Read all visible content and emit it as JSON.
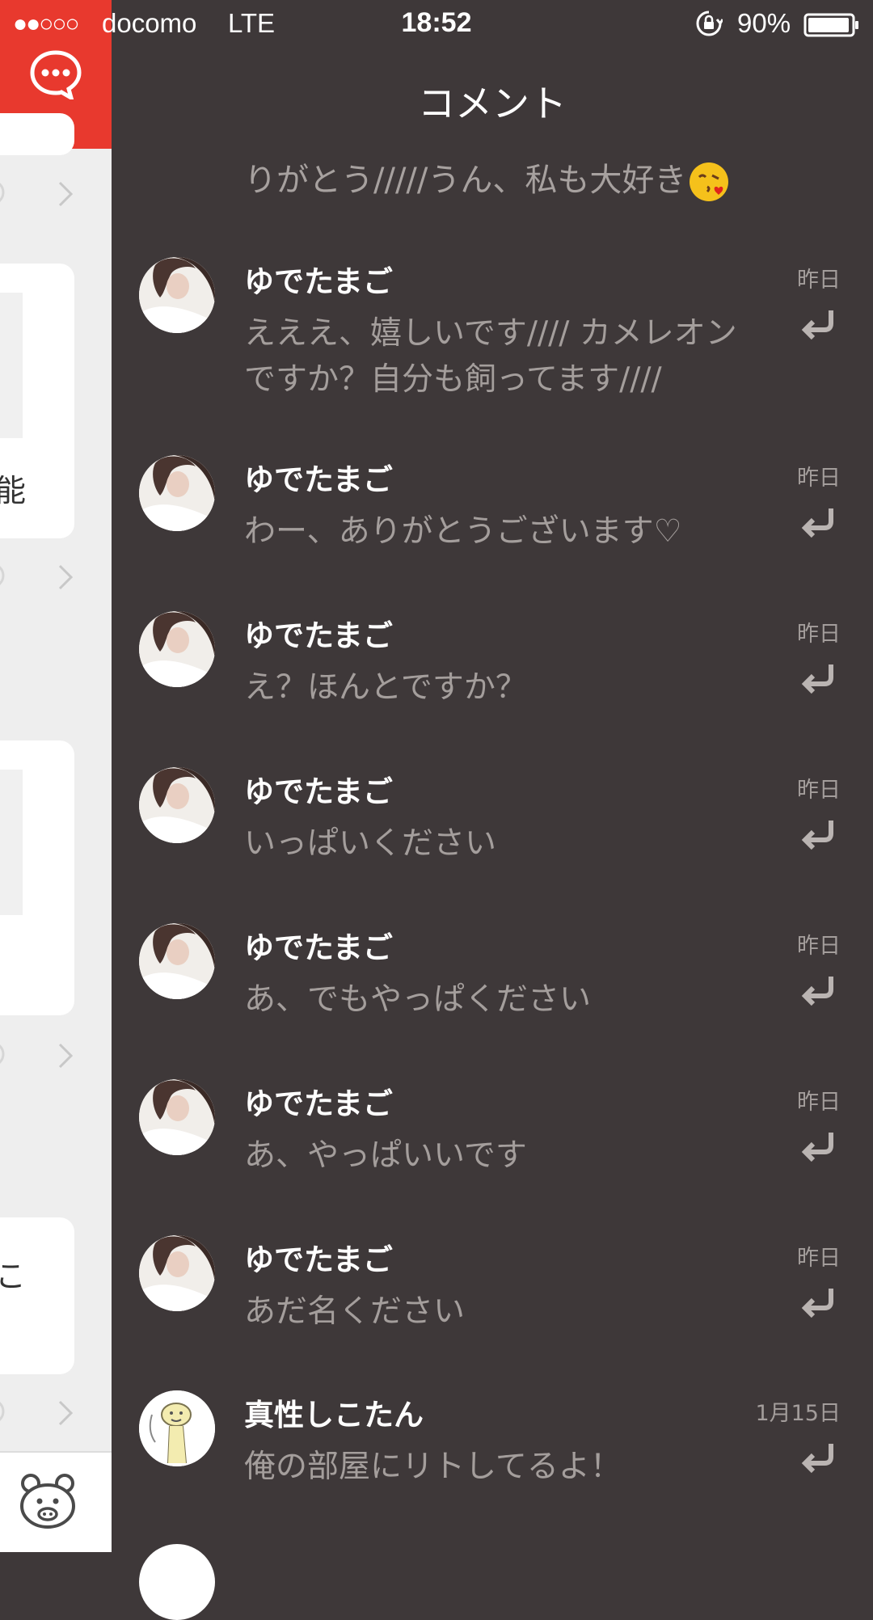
{
  "status_bar": {
    "signal": "●●○○○",
    "carrier": "docomo",
    "network": "LTE",
    "time": "18:52",
    "battery": "90%"
  },
  "header": {
    "title": "コメント"
  },
  "left_app": {
    "fragments": [
      "能",
      "こ"
    ]
  },
  "partial_comment": {
    "text": "りがとう/////うん、私も大好き",
    "emoji": "kissing-face-icon"
  },
  "comments": [
    {
      "name": "ゆでたまご",
      "date": "昨日",
      "text": "えええ、嬉しいです//// カメレオンですか？自分も飼ってます////",
      "avatar": "girl-photo"
    },
    {
      "name": "ゆでたまご",
      "date": "昨日",
      "text": "わー、ありがとうございます♡",
      "avatar": "girl-photo"
    },
    {
      "name": "ゆでたまご",
      "date": "昨日",
      "text": "え？ほんとですか？",
      "avatar": "girl-photo"
    },
    {
      "name": "ゆでたまご",
      "date": "昨日",
      "text": "いっぱいください",
      "avatar": "girl-photo"
    },
    {
      "name": "ゆでたまご",
      "date": "昨日",
      "text": "あ、でもやっぱください",
      "avatar": "girl-photo"
    },
    {
      "name": "ゆでたまご",
      "date": "昨日",
      "text": "あ、やっぱいいです",
      "avatar": "girl-photo"
    },
    {
      "name": "ゆでたまご",
      "date": "昨日",
      "text": "あだ名ください",
      "avatar": "girl-photo"
    },
    {
      "name": "真性しこたん",
      "date": "1月15日",
      "text": "俺の部屋にリトしてるよ！",
      "avatar": "cartoon-drawing"
    }
  ],
  "colors": {
    "panel_bg": "#3e3839",
    "accent_red": "#e8392e",
    "name_text": "#ffffff",
    "body_text": "#a49e9c"
  }
}
